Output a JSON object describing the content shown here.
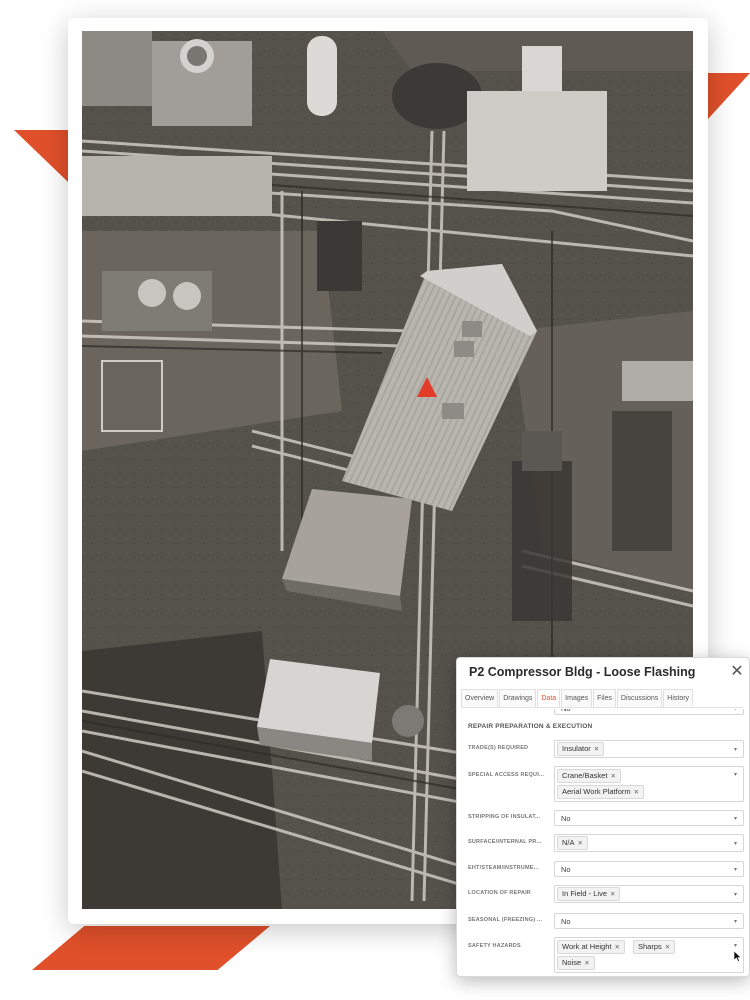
{
  "colors": {
    "accent": "#e0502a",
    "marker": "#e23c28"
  },
  "scene": {
    "marker_icon": "location-pin-icon"
  },
  "panel": {
    "title": "P2 Compressor Bldg - Loose Flashing",
    "close_icon": "close-icon",
    "tabs": [
      {
        "label": "Overview",
        "active": false
      },
      {
        "label": "Drawings",
        "active": false
      },
      {
        "label": "Data",
        "active": true
      },
      {
        "label": "Images",
        "active": false
      },
      {
        "label": "Files",
        "active": false
      },
      {
        "label": "Discussions",
        "active": false
      },
      {
        "label": "History",
        "active": false
      }
    ],
    "cut_row_value": "No",
    "section_title": "REPAIR PREPARATION & EXECUTION",
    "fields": [
      {
        "label": "TRADE(S) REQUIRED",
        "chips": [
          "Insulator"
        ]
      },
      {
        "label": "SPECIAL ACCESS REQUI...",
        "chips": [
          "Crane/Basket",
          "Aerial Work Platform"
        ]
      },
      {
        "label": "STRIPPING OF INSULAT...",
        "value": "No"
      },
      {
        "label": "SURFACE/INTERNAL PR...",
        "chips": [
          "N/A"
        ]
      },
      {
        "label": "EHT/STEAM/INSTRUME...",
        "value": "No"
      },
      {
        "label": "LOCATION OF REPAIR",
        "chips": [
          "In Field - Live"
        ]
      },
      {
        "label": "SEASONAL (FREEZING) ...",
        "value": "No"
      },
      {
        "label": "SAFETY HAZARDS",
        "chips": [
          "Work at Height",
          "Sharps",
          "Noise"
        ]
      }
    ]
  }
}
